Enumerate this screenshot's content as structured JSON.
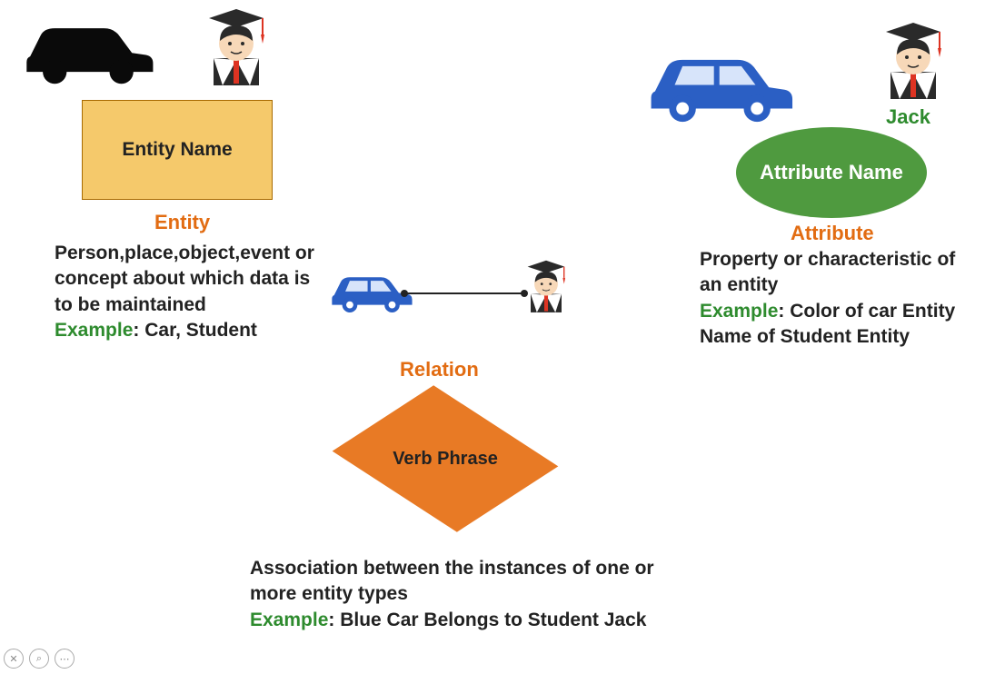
{
  "entity": {
    "shape_label": "Entity Name",
    "heading": "Entity",
    "description_a": "Person,place,object,event or concept about which data is to be maintained",
    "example_prefix": "Example",
    "example_text": ": Car, Student"
  },
  "attribute": {
    "shape_label": "Attribute Name",
    "heading": "Attribute",
    "jack_label": "Jack",
    "description_a": "Property or characteristic of an entity",
    "example_prefix": "Example",
    "example_text": ": Color of car Entity Name of Student Entity"
  },
  "relation": {
    "shape_label": "Verb Phrase",
    "heading": "Relation",
    "description_a": "Association between the instances of one or more entity types",
    "example_prefix": "Example",
    "example_text": ": Blue Car Belongs to Student Jack"
  },
  "icons": {
    "car_black": "car-icon",
    "car_blue": "car-icon",
    "student": "student-icon"
  }
}
